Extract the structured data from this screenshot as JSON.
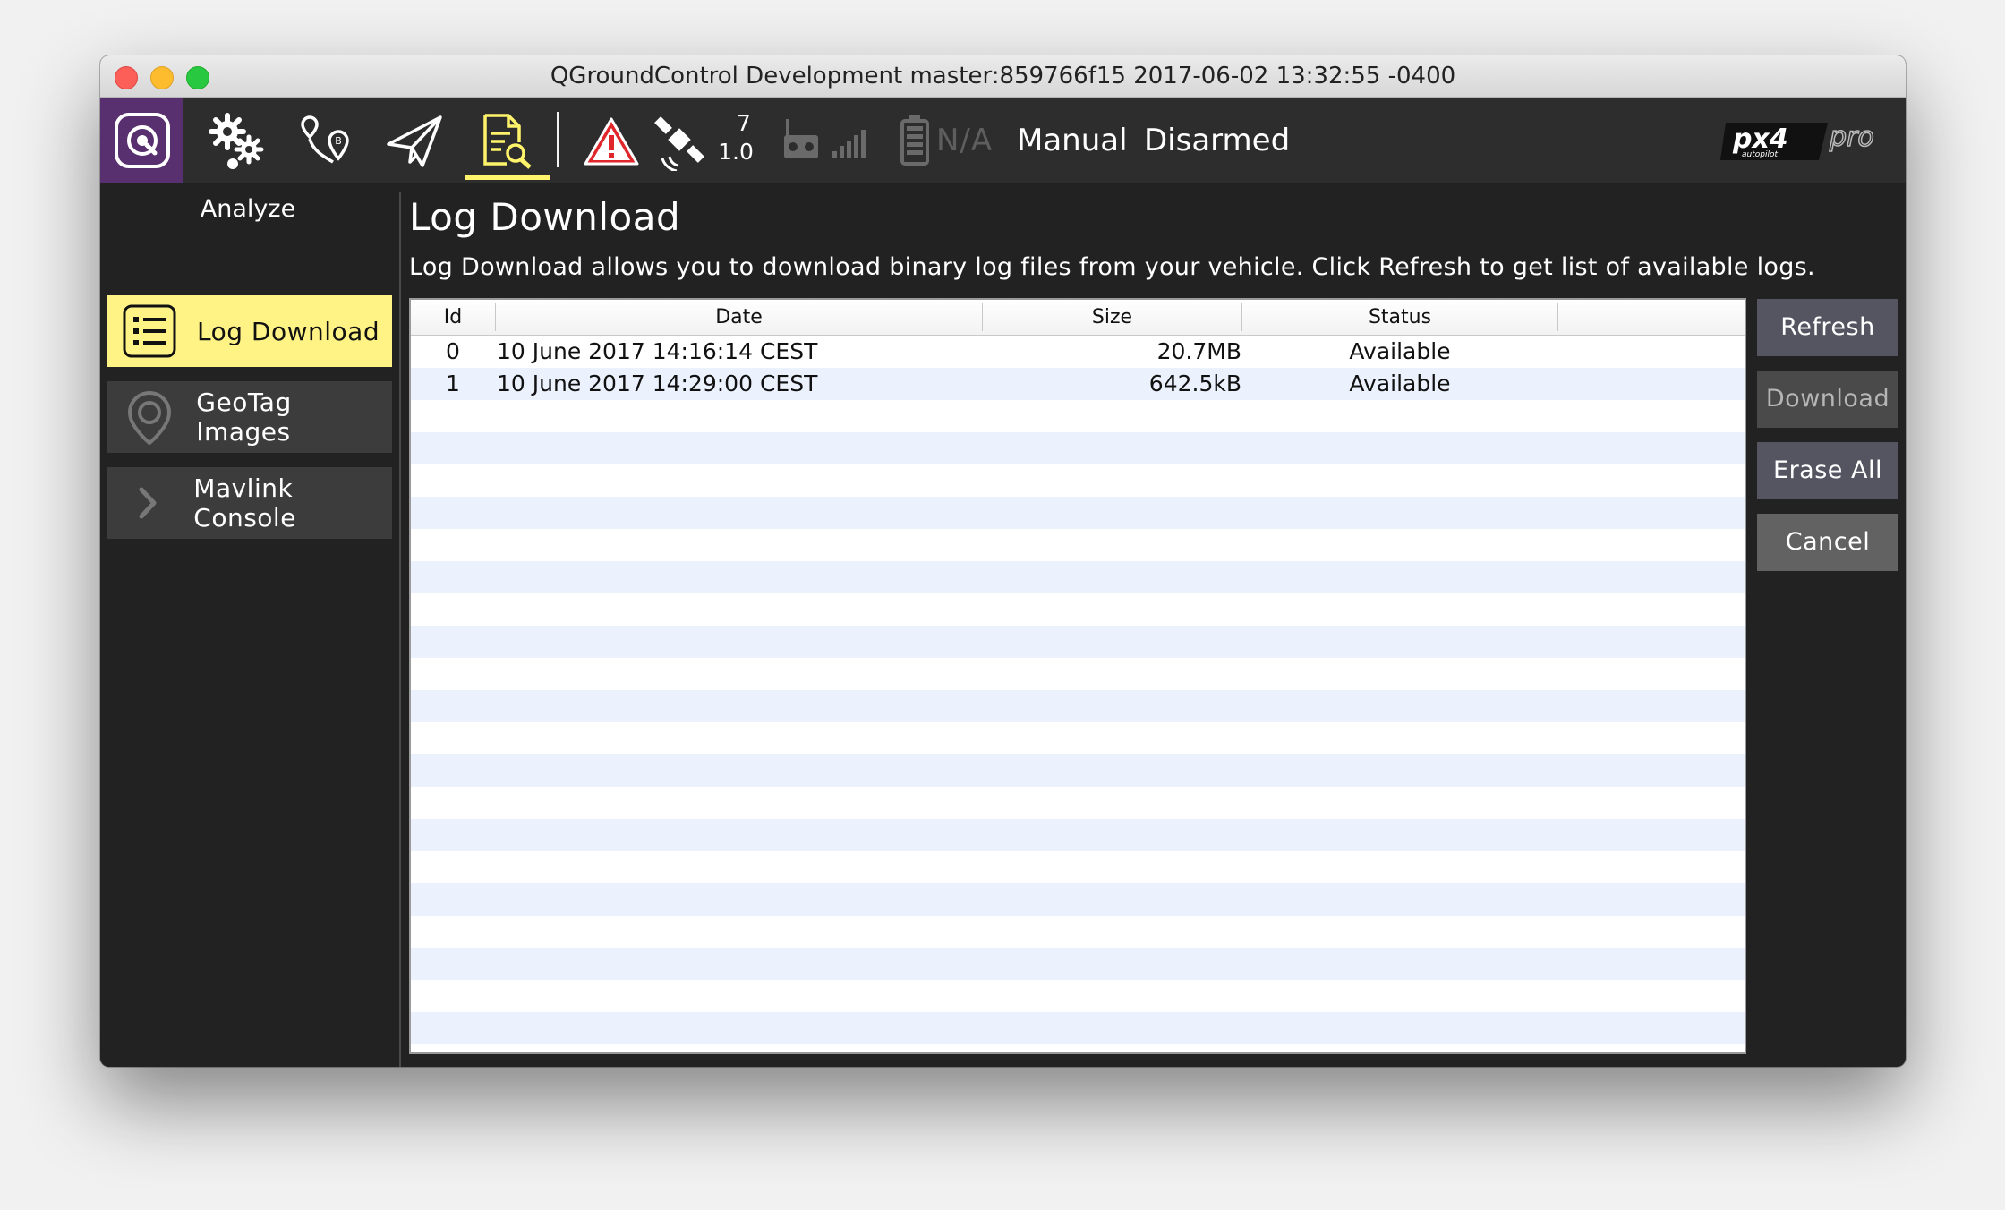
{
  "window": {
    "title": "QGroundControl Development master:859766f15 2017-06-02 13:32:55 -0400"
  },
  "toolbar": {
    "icons": [
      "qgc-logo-icon",
      "settings-gears-icon",
      "plan-route-icon",
      "fly-paper-plane-icon",
      "analyze-document-icon",
      "warning-icon",
      "gps-satellite-icon",
      "rc-remote-icon",
      "signal-bars-icon",
      "battery-icon"
    ],
    "gps_count": "7",
    "gps_hdop": "1.0",
    "battery": "N/A",
    "flight_mode": "Manual",
    "armed_state": "Disarmed",
    "brand_icon": "px4-pro-logo-icon",
    "colors": {
      "accent": "#fff36b",
      "logo_bg": "#58306f",
      "warning": "#e0262b"
    }
  },
  "sidebar": {
    "title": "Analyze",
    "items": [
      {
        "label": "Log Download",
        "icon": "list-icon",
        "active": true
      },
      {
        "label": "GeoTag Images",
        "icon": "map-pin-icon",
        "active": false
      },
      {
        "label": "Mavlink Console",
        "icon": "chevron-right-icon",
        "active": false
      }
    ]
  },
  "main": {
    "title": "Log Download",
    "description": "Log Download allows you to download binary log files from your vehicle. Click Refresh to get list of available logs."
  },
  "table": {
    "headers": {
      "id": "Id",
      "date": "Date",
      "size": "Size",
      "status": "Status"
    },
    "rows": [
      {
        "id": "0",
        "date": "10 June 2017 14:16:14 CEST",
        "size": "20.7MB",
        "status": "Available"
      },
      {
        "id": "1",
        "date": "10 June 2017 14:29:00 CEST",
        "size": "642.5kB",
        "status": "Available"
      }
    ]
  },
  "buttons": {
    "refresh": "Refresh",
    "download": "Download",
    "erase_all": "Erase All",
    "cancel": "Cancel"
  }
}
